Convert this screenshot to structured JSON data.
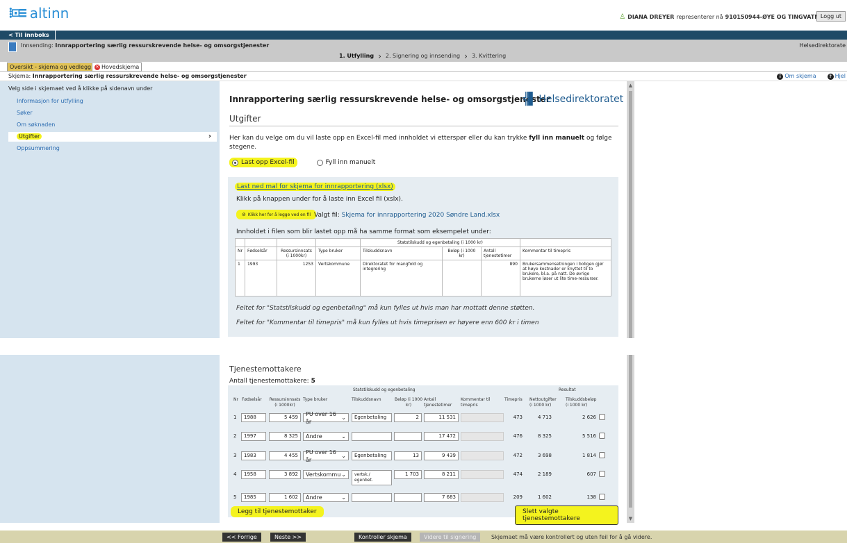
{
  "header": {
    "logo_text": "altinn",
    "user_name": "DIANA DREYER",
    "represents_text": "representerer nå",
    "org": "910150944-ØYE OG TINGVATN",
    "logout_label": "Logg ut"
  },
  "nav": {
    "to_inbox": "< Til innboks"
  },
  "submission": {
    "prefix": "Innsending:",
    "title": "Innrapportering særlig ressurskrevende helse- og omsorgstjenester",
    "org_right": "Helsedirektorate",
    "steps": [
      "1. Utfylling",
      "2. Signering og innsending",
      "3. Kvittering"
    ]
  },
  "tabs": {
    "overview": "Oversikt - skjema og vedlegg",
    "main": "Hovedskjema"
  },
  "form_header": {
    "prefix": "Skjema:",
    "title": "Innrapportering særlig ressurskrevende helse- og omsorgstjenester",
    "about": "Om skjema",
    "help": "Hjel"
  },
  "sidebar": {
    "hint": "Velg side i skjemaet ved å klikke på sidenavn under",
    "items": [
      {
        "label": "Informasjon for utfylling"
      },
      {
        "label": "Søker"
      },
      {
        "label": "Om søknaden"
      },
      {
        "label": "Utgifter"
      },
      {
        "label": "Oppsummering"
      }
    ]
  },
  "main": {
    "form_title": "Innrapportering særlig ressurskrevende helse- og omsorgstjenester",
    "brand": "Helsedirektoratet",
    "section": "Utgifter",
    "intro_1": "Her kan du velge om du vil laste opp en Excel-fil med innholdet vi etterspør eller du kan trykke ",
    "intro_bold": "fyll inn manuelt",
    "intro_2": " og følge stegene.",
    "radio_upload": "Last opp Excel-fil",
    "radio_manual": "Fyll inn manuelt",
    "download_link": "Last ned mal for skjema for innrapportering (xlsx)",
    "click_text": "Klikk på knappen under for å laste inn Excel fil (xslx).",
    "upload_button": "Klikk her for å legge ved en fil",
    "chosen_label": "Valgt fil:",
    "chosen_file": "Skjema for innrapportering 2020 Søndre Land.xlsx",
    "format_text": "Innholdet i filen som blir lastet opp må ha samme format som eksempelet under:",
    "example": {
      "group": "Statstilskudd og egenbetaling (i 1000 kr)",
      "headers": [
        "Nr",
        "Fødselsår",
        "Ressursinnsats (i 1000kr)",
        "Type bruker",
        "Tilskuddsnavn",
        "Beløp (i 1000 kr)",
        "Antall tjenestetimer",
        "Kommentar til timepris"
      ],
      "row": [
        "1",
        "1993",
        "1253",
        "Vertskommune",
        "Direktoratet for mangfold og integrering",
        "",
        "890",
        "Brukersammensetningen i boligen gjør at høye kostnader er knyttet til to brukere, bl.a. på natt. De øvrige brukerne løser ut lite time-ressurser."
      ]
    },
    "note1": "Feltet for \"Statstilskudd og egenbetaling\" må kun fylles ut hvis man har mottatt denne støtten.",
    "note2": "Feltet for \"Kommentar til timepris\" må kun fylles ut hvis timeprisen er høyere enn 600 kr i timen"
  },
  "recipients": {
    "title": "Tjenestemottakere",
    "count_label": "Antall tjenestemottakere:",
    "count": "5",
    "group_subsidy": "Statstilskudd og egenbetaling",
    "group_result": "Resultat",
    "headers": {
      "nr": "Nr",
      "birth": "Fødselsår",
      "resource": "Ressursinnsats (i 1000kr)",
      "type": "Type bruker",
      "subsidy_name": "Tilskuddsnavn",
      "amount": "Beløp (i 1000 kr)",
      "hours": "Antall tjenestetimer",
      "comment": "Kommentar til timepris",
      "hour_price": "Timepris",
      "net": "Nettoutgifter (i 1000 kr)",
      "grant": "Tilskuddsbeløp (i 1000 kr)"
    },
    "rows": [
      {
        "nr": "1",
        "birth": "1988",
        "resource": "5 459",
        "type": "PU over 16 år",
        "subsidy_name": "Egenbetaling",
        "amount": "2",
        "hours": "11 531",
        "hour_price": "473",
        "net": "4 713",
        "grant": "2 626"
      },
      {
        "nr": "2",
        "birth": "1997",
        "resource": "8 325",
        "type": "Andre",
        "subsidy_name": "",
        "amount": "",
        "hours": "17 472",
        "hour_price": "476",
        "net": "8 325",
        "grant": "5 516"
      },
      {
        "nr": "3",
        "birth": "1983",
        "resource": "4 455",
        "type": "PU over 16 år",
        "subsidy_name": "Egenbetaling",
        "amount": "13",
        "hours": "9 439",
        "hour_price": "472",
        "net": "3 698",
        "grant": "1 814"
      },
      {
        "nr": "4",
        "birth": "1958",
        "resource": "3 892",
        "type": "Vertskommune",
        "subsidy_name": "vertsk./ egenbet.",
        "amount": "1 703",
        "hours": "8 211",
        "hour_price": "474",
        "net": "2 189",
        "grant": "607"
      },
      {
        "nr": "5",
        "birth": "1985",
        "resource": "1 602",
        "type": "Andre",
        "subsidy_name": "",
        "amount": "",
        "hours": "7 683",
        "hour_price": "209",
        "net": "1 602",
        "grant": "138"
      }
    ],
    "add_button": "Legg til tjenestemottaker",
    "delete_button": "Slett valgte tjenestemottakere"
  },
  "bottombar": {
    "prev": "<< Forrige",
    "next": "Neste >>",
    "check": "Kontroller skjema",
    "proceed": "Videre til signering",
    "message": "Skjemaet må være kontrollert og uten feil for å gå videre."
  },
  "colors": {
    "highlight": "#f4f31e",
    "navbar": "#1f4a66",
    "sidebar": "#d6e4ef",
    "link": "#2a6bb0"
  }
}
